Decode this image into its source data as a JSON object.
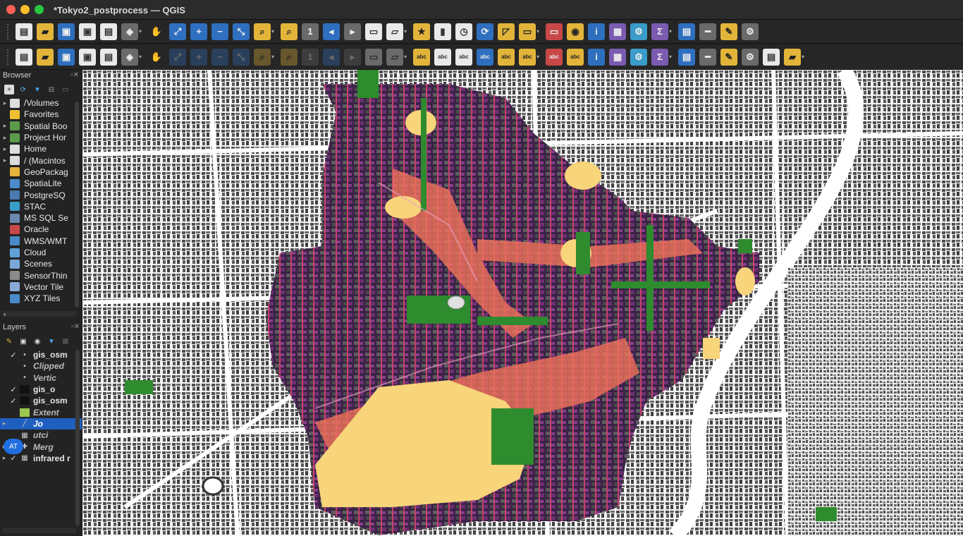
{
  "window": {
    "title": "*Tokyo2_postprocess — QGIS"
  },
  "toolbar1": {
    "icons": [
      "new-project-icon",
      "open-project-icon",
      "save-project-icon",
      "save-as-icon",
      "print-layout-icon",
      "style-manager-icon",
      "pan-hand-icon",
      "pan-to-selection-icon",
      "zoom-in-icon",
      "zoom-out-icon",
      "zoom-full-icon",
      "zoom-to-selection-icon",
      "zoom-to-layer-icon",
      "zoom-native-icon",
      "zoom-last-icon",
      "zoom-next-icon",
      "new-map-view-icon",
      "new-3d-view-icon",
      "new-bookmark-icon",
      "show-bookmarks-icon",
      "temporal-controller-icon",
      "refresh-icon",
      "select-feature-icon",
      "select-by-expression-icon",
      "deselect-icon",
      "select-by-location-icon",
      "identify-icon",
      "attribute-table-icon",
      "toolbox-icon",
      "statistics-icon",
      "field-calculator-icon",
      "measure-icon",
      "map-tips-icon",
      "settings-gear-icon"
    ]
  },
  "toolbar2": {
    "icons": [
      "data-source-manager-icon",
      "new-geopackage-icon",
      "new-shapefile-icon",
      "digitize-icon",
      "new-temp-layer-icon",
      "new-virtual-layer-icon",
      "new-spatialite-icon",
      "toggle-editing-icon",
      "save-edits-icon",
      "add-feature-icon",
      "vertex-tool-icon",
      "modify-attributes-icon",
      "delete-selected-icon",
      "cut-features-icon",
      "copy-features-icon",
      "paste-features-icon",
      "undo-icon",
      "redo-icon",
      "label-abc-icon",
      "label-pin-icon",
      "label-highlight-icon",
      "label-move-icon",
      "label-rotate-icon",
      "label-change-icon",
      "label-show-icon",
      "label-diagram-icon",
      "gps-icon",
      "python-console-icon",
      "processing-icon",
      "rubber-band-icon",
      "point-icon",
      "plugin-icon",
      "plugin-2-icon",
      "help-icon",
      "search-icon",
      "analysis-icon"
    ],
    "label_text": "abc"
  },
  "browser": {
    "title": "Browser",
    "items": [
      {
        "label": "/Volumes",
        "icon": "folder-icon",
        "expandable": true
      },
      {
        "label": "Favorites",
        "icon": "star-icon",
        "expandable": false
      },
      {
        "label": "Spatial Boo",
        "icon": "spatial-bookmarks-icon",
        "expandable": true
      },
      {
        "label": "Project Hor",
        "icon": "project-home-icon",
        "expandable": true
      },
      {
        "label": "Home",
        "icon": "home-folder-icon",
        "expandable": true
      },
      {
        "label": "/ (Macintos",
        "icon": "folder-icon",
        "expandable": true
      },
      {
        "label": "GeoPackag",
        "icon": "geopackage-icon",
        "expandable": false
      },
      {
        "label": "SpatiaLite",
        "icon": "spatialite-icon",
        "expandable": false
      },
      {
        "label": "PostgreSQ",
        "icon": "postgresql-icon",
        "expandable": false
      },
      {
        "label": "STAC",
        "icon": "stac-icon",
        "expandable": false
      },
      {
        "label": "MS SQL Se",
        "icon": "mssql-icon",
        "expandable": false
      },
      {
        "label": "Oracle",
        "icon": "oracle-icon",
        "expandable": false
      },
      {
        "label": "WMS/WMT",
        "icon": "wms-icon",
        "expandable": false
      },
      {
        "label": "Cloud",
        "icon": "cloud-icon",
        "expandable": false
      },
      {
        "label": "Scenes",
        "icon": "scenes-icon",
        "expandable": false
      },
      {
        "label": "SensorThin",
        "icon": "sensorthings-icon",
        "expandable": false
      },
      {
        "label": "Vector Tile",
        "icon": "vector-tiles-icon",
        "expandable": false
      },
      {
        "label": "XYZ Tiles",
        "icon": "xyz-tiles-icon",
        "expandable": false
      }
    ]
  },
  "layers": {
    "title": "Layers",
    "items": [
      {
        "label": "gis_osm",
        "checked": true,
        "italic": false,
        "selected": false,
        "icon": "point-layer-icon"
      },
      {
        "label": "Clipped",
        "checked": false,
        "italic": true,
        "selected": false,
        "icon": "point-layer-icon"
      },
      {
        "label": "Vertic",
        "checked": false,
        "italic": true,
        "selected": false,
        "icon": "point-layer-icon"
      },
      {
        "label": "gis_o",
        "checked": true,
        "italic": false,
        "selected": false,
        "icon": "polygon-layer-icon"
      },
      {
        "label": "gis_osm",
        "checked": true,
        "italic": false,
        "selected": false,
        "icon": "polygon-layer-icon"
      },
      {
        "label": "Extent",
        "checked": false,
        "italic": true,
        "selected": false,
        "icon": "extent-layer-icon"
      },
      {
        "label": "Jo",
        "checked": false,
        "italic": true,
        "selected": true,
        "icon": "line-layer-icon"
      },
      {
        "label": "utci",
        "checked": false,
        "italic": true,
        "selected": false,
        "icon": "raster-layer-icon"
      },
      {
        "label": "Merg",
        "checked": false,
        "italic": true,
        "selected": false,
        "icon": "group-icon"
      },
      {
        "label": "infrared r",
        "checked": true,
        "italic": false,
        "selected": false,
        "icon": "raster-layer-icon"
      }
    ],
    "avatar": "AT"
  },
  "colors": {
    "heat_low": "#2a1e3c",
    "heat_mid": "#8e3b8c",
    "heat_high": "#f0725a",
    "heat_peak": "#f8d47a",
    "parks": "#2e8b2e",
    "buildings": "#555555",
    "background": "#f2f2f2"
  }
}
